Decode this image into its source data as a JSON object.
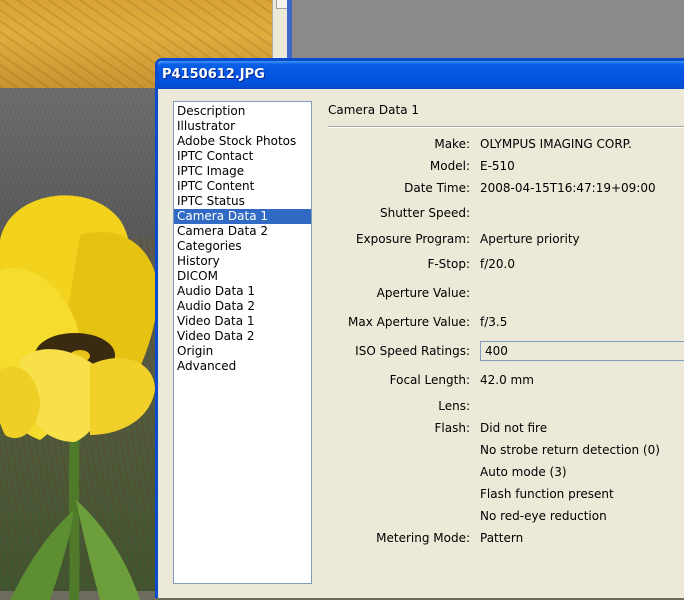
{
  "window": {
    "title": "P4150612.JPG"
  },
  "categories": [
    {
      "label": "Description",
      "selected": false
    },
    {
      "label": "Illustrator",
      "selected": false
    },
    {
      "label": "Adobe Stock Photos",
      "selected": false
    },
    {
      "label": "IPTC Contact",
      "selected": false
    },
    {
      "label": "IPTC Image",
      "selected": false
    },
    {
      "label": "IPTC Content",
      "selected": false
    },
    {
      "label": "IPTC Status",
      "selected": false
    },
    {
      "label": "Camera Data 1",
      "selected": true
    },
    {
      "label": "Camera Data 2",
      "selected": false
    },
    {
      "label": "Categories",
      "selected": false
    },
    {
      "label": "History",
      "selected": false
    },
    {
      "label": "DICOM",
      "selected": false
    },
    {
      "label": "Audio Data 1",
      "selected": false
    },
    {
      "label": "Audio Data 2",
      "selected": false
    },
    {
      "label": "Video Data 1",
      "selected": false
    },
    {
      "label": "Video Data 2",
      "selected": false
    },
    {
      "label": "Origin",
      "selected": false
    },
    {
      "label": "Advanced",
      "selected": false
    }
  ],
  "panel": {
    "title": "Camera Data 1",
    "fields": {
      "make": {
        "label": "Make:",
        "value": "OLYMPUS IMAGING CORP."
      },
      "model": {
        "label": "Model:",
        "value": "E-510"
      },
      "date_time": {
        "label": "Date Time:",
        "value": "2008-04-15T16:47:19+09:00"
      },
      "shutter_speed": {
        "label": "Shutter Speed:",
        "value": ""
      },
      "exposure_program": {
        "label": "Exposure Program:",
        "value": "Aperture priority"
      },
      "f_stop": {
        "label": "F-Stop:",
        "value": "f/20.0"
      },
      "aperture_value": {
        "label": "Aperture Value:",
        "value": ""
      },
      "max_aperture_value": {
        "label": "Max Aperture Value:",
        "value": "f/3.5"
      },
      "iso_speed": {
        "label": "ISO Speed Ratings:",
        "value": "400"
      },
      "focal_length": {
        "label": "Focal Length:",
        "value": "42.0 mm"
      },
      "lens": {
        "label": "Lens:",
        "value": ""
      },
      "flash": {
        "label": "Flash:",
        "values": [
          "Did not fire",
          "No strobe return detection (0)",
          "Auto mode (3)",
          "Flash function present",
          "No red-eye reduction"
        ]
      },
      "metering_mode": {
        "label": "Metering Mode:",
        "value": "Pattern"
      }
    }
  },
  "colors": {
    "titlebar": "#0554e3",
    "selection": "#316ac5",
    "dialog_bg": "#ece9d8"
  }
}
